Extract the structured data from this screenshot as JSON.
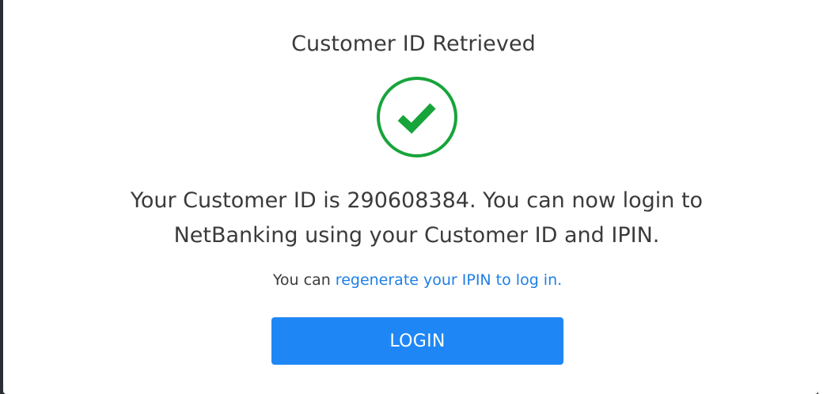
{
  "dialog": {
    "title": "Customer ID Retrieved",
    "status_icon": "check-circle-icon",
    "message_line1": "Your Customer ID is 290608384. You can now login to",
    "message_line2": "NetBanking using your Customer ID and IPIN.",
    "hint_prefix": "You can ",
    "hint_link": "regenerate your IPIN to log in.",
    "login_label": "LOGIN"
  },
  "colors": {
    "success_green": "#17a43b",
    "link_blue": "#1e7fe4",
    "button_blue": "#1f87f5",
    "text": "#3b3b3b"
  }
}
